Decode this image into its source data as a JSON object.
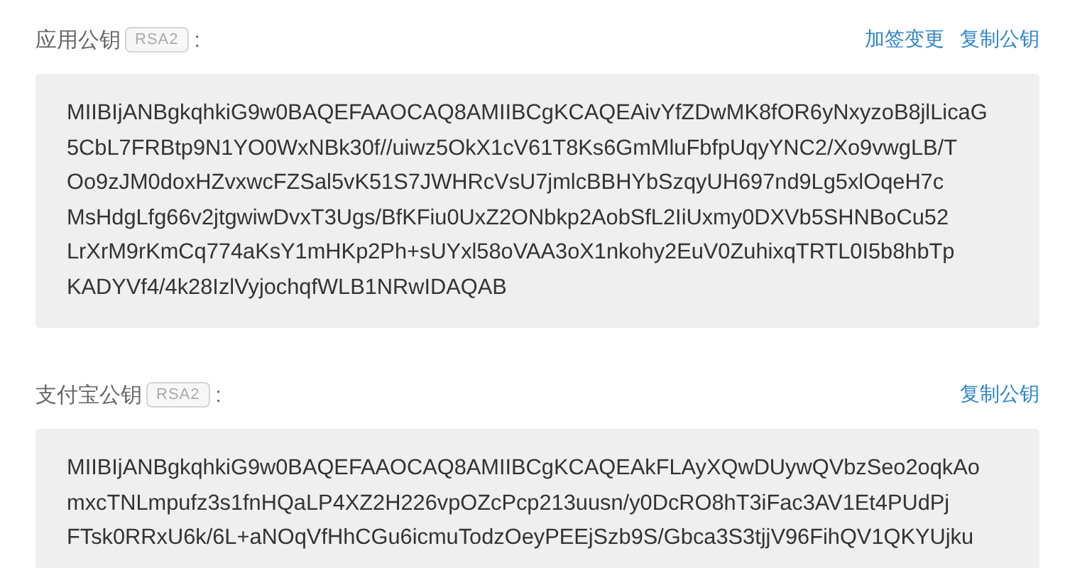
{
  "sections": [
    {
      "title": "应用公钥",
      "badge": "RSA2",
      "colon": ":",
      "actions": [
        "加签变更",
        "复制公钥"
      ],
      "key_lines": [
        "MIIBIjANBgkqhkiG9w0BAQEFAAOCAQ8AMIIBCgKCAQEAivYfZDwMK8fOR6yNxyzoB8jlLicaG",
        "5CbL7FRBtp9N1YO0WxNBk30f//uiwz5OkX1cV61T8Ks6GmMluFbfpUqyYNC2/Xo9vwgLB/T",
        "Oo9zJM0doxHZvxwcFZSal5vK51S7JWHRcVsU7jmlcBBHYbSzqyUH697nd9Lg5xlOqeH7c",
        "MsHdgLfg66v2jtgwiwDvxT3Ugs/BfKFiu0UxZ2ONbkp2AobSfL2IiUxmy0DXVb5SHNBoCu52",
        "LrXrM9rKmCq774aKsY1mHKp2Ph+sUYxl58oVAA3oX1nkohy2EuV0ZuhixqTRTL0I5b8hbTp",
        "KADYVf4/4k28IzlVyjochqfWLB1NRwIDAQAB"
      ]
    },
    {
      "title": "支付宝公钥",
      "badge": "RSA2",
      "colon": ":",
      "actions": [
        "复制公钥"
      ],
      "key_lines": [
        "MIIBIjANBgkqhkiG9w0BAQEFAAOCAQ8AMIIBCgKCAQEAkFLAyXQwDUywQVbzSeo2oqkAo",
        "mxcTNLmpufz3s1fnHQaLP4XZ2H226vpOZcPcp213uusn/y0DcRO8hT3iFac3AV1Et4PUdPj",
        "FTsk0RRxU6k/6L+aNOqVfHhCGu6icmuTodzOeyPEEjSzb9S/Gbca3S3tjjV96FihQV1QKYUjku"
      ]
    }
  ]
}
